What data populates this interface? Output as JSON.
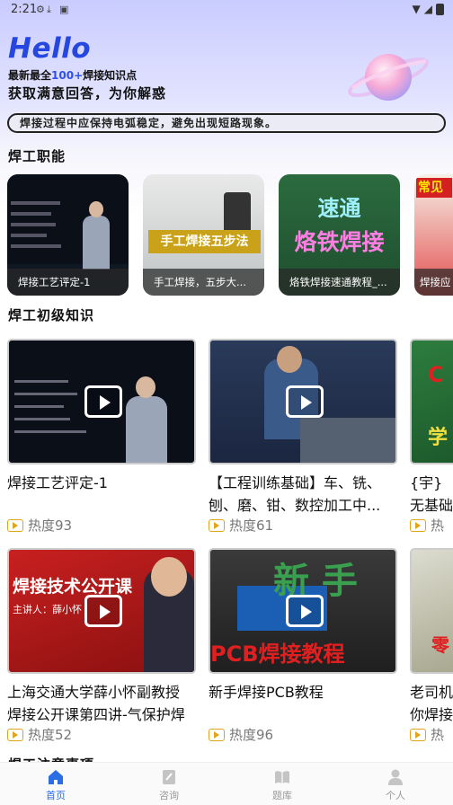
{
  "status": {
    "time": "2:21"
  },
  "header": {
    "hello": "Hello",
    "sub1_prefix": "最新最全",
    "sub1_highlight": "100+",
    "sub1_suffix": "焊接知识点",
    "sub2": "获取满意回答，为你解惑"
  },
  "tip": "焊接过程中应保持电弧稳定，避免出现短路现象。",
  "sections": {
    "career": "焊工职能",
    "basic": "焊工初级知识",
    "notice": "焊工注意事项"
  },
  "career_cards": [
    {
      "caption": "焊接工艺评定-1"
    },
    {
      "caption": "手工焊接，五步大...",
      "overlay": "手工焊接五步法"
    },
    {
      "caption": "烙铁焊接速通教程_...",
      "overlay1": "速通",
      "overlay2": "烙铁焊接"
    },
    {
      "caption": "焊接应",
      "overlay": "常见"
    }
  ],
  "videos": [
    {
      "title": "焊接工艺评定-1",
      "heat": "热度93"
    },
    {
      "title": "【工程训练基础】车、铣、\n刨、磨、钳、数控加工中...",
      "heat": "热度61"
    },
    {
      "title": "{宇}\n无基础",
      "heat": "热"
    },
    {
      "title": "上海交通大学薛小怀副教授\n焊接公开课第四讲-气保护焊",
      "heat": "热度52",
      "overlay_top": "焊接技术公开课",
      "overlay_name": "主讲人：薛小怀"
    },
    {
      "title": "新手焊接PCB教程",
      "heat": "热度96",
      "overlay_top": "新 手",
      "overlay_bottom": "PCB焊接教程"
    },
    {
      "title": "老司机\n你焊接",
      "heat": "热"
    }
  ],
  "tabs": [
    {
      "label": "首页",
      "icon": "home-icon"
    },
    {
      "label": "咨询",
      "icon": "note-icon"
    },
    {
      "label": "题库",
      "icon": "book-icon"
    },
    {
      "label": "个人",
      "icon": "person-icon"
    }
  ],
  "colors": {
    "accent": "#2646e0",
    "tab_active": "#2a6ee6",
    "heat": "#e0a51a"
  }
}
